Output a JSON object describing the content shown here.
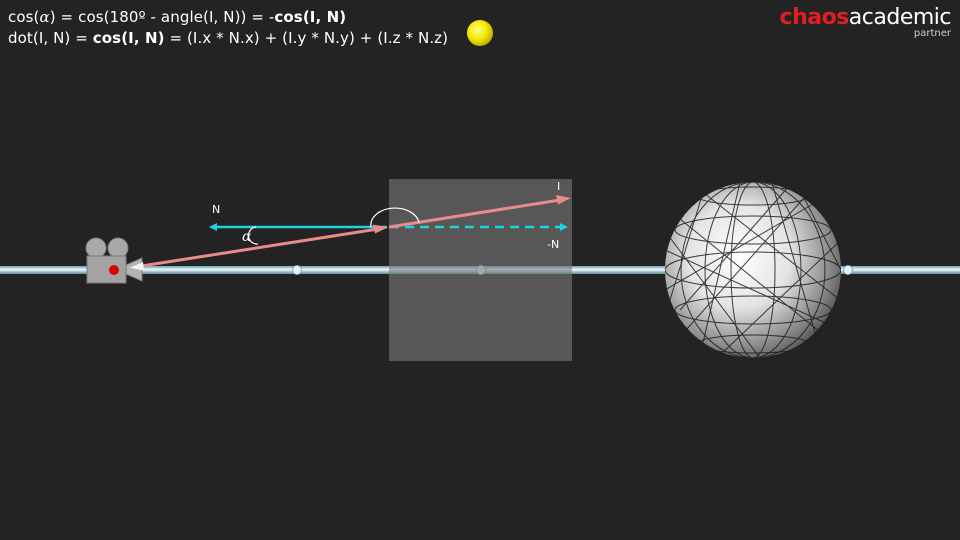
{
  "formulas": {
    "line1": {
      "a": "cos(",
      "alpha": "α",
      "b": ") = cos(180º - angle(I, N)) = -",
      "bold": "cos(I, N)"
    },
    "line2": {
      "a": "dot(I, N) = ",
      "bold": "cos(I, N)",
      "b": " = (I.x * N.x) + (I.y * N.y) + (I.z * N.z)"
    }
  },
  "logo": {
    "brand_red": "chaos",
    "brand_white": "academic",
    "subtitle": "partner"
  },
  "diagram": {
    "labels": {
      "n": "N",
      "neg_n": "-N",
      "i": "I",
      "alpha": "α"
    }
  },
  "colors": {
    "background": "#232323",
    "normal_arrow": "#1fd3dc",
    "incident_ray": "#e98b8b",
    "light": "#f4ea00",
    "plane": "#6b6b6b",
    "brand_red": "#e01e25"
  },
  "icons": [
    "camera-icon",
    "light-source-icon",
    "sphere-icon"
  ]
}
